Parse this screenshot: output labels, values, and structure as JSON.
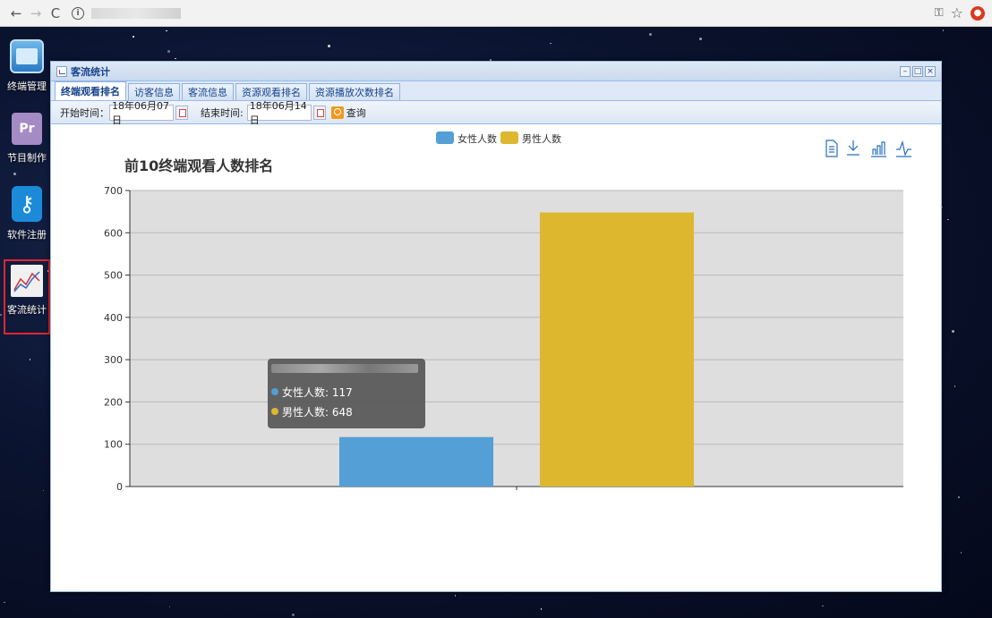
{
  "window": {
    "title": "客流统计"
  },
  "desktop": [
    {
      "label": "终端管理"
    },
    {
      "label": "节目制作",
      "icon_text": "Pr"
    },
    {
      "label": "软件注册"
    },
    {
      "label": "客流统计"
    }
  ],
  "tabs": [
    "终端观看排名",
    "访客信息",
    "客流信息",
    "资源观看排名",
    "资源播放次数排名"
  ],
  "toolbar": {
    "start_label": "开始时间：",
    "start_value": "18年06月07日",
    "end_label": "结束时间:",
    "end_value": "18年06月14日",
    "query_label": "查询"
  },
  "tooltip": {
    "female": "女性人数: 117",
    "male": "男性人数: 648"
  },
  "colors": {
    "female": "#539fd6",
    "male": "#ddb82e",
    "grid_bg": "#dedede"
  },
  "chart_data": {
    "type": "bar",
    "title": "前10终端观看人数排名",
    "categories": [
      ""
    ],
    "series": [
      {
        "name": "女性人数",
        "values": [
          117
        ]
      },
      {
        "name": "男性人数",
        "values": [
          648
        ]
      }
    ],
    "ylim": [
      0,
      700
    ],
    "yticks": [
      0,
      100,
      200,
      300,
      400,
      500,
      600,
      700
    ],
    "grid": true,
    "legend": "top-center"
  }
}
